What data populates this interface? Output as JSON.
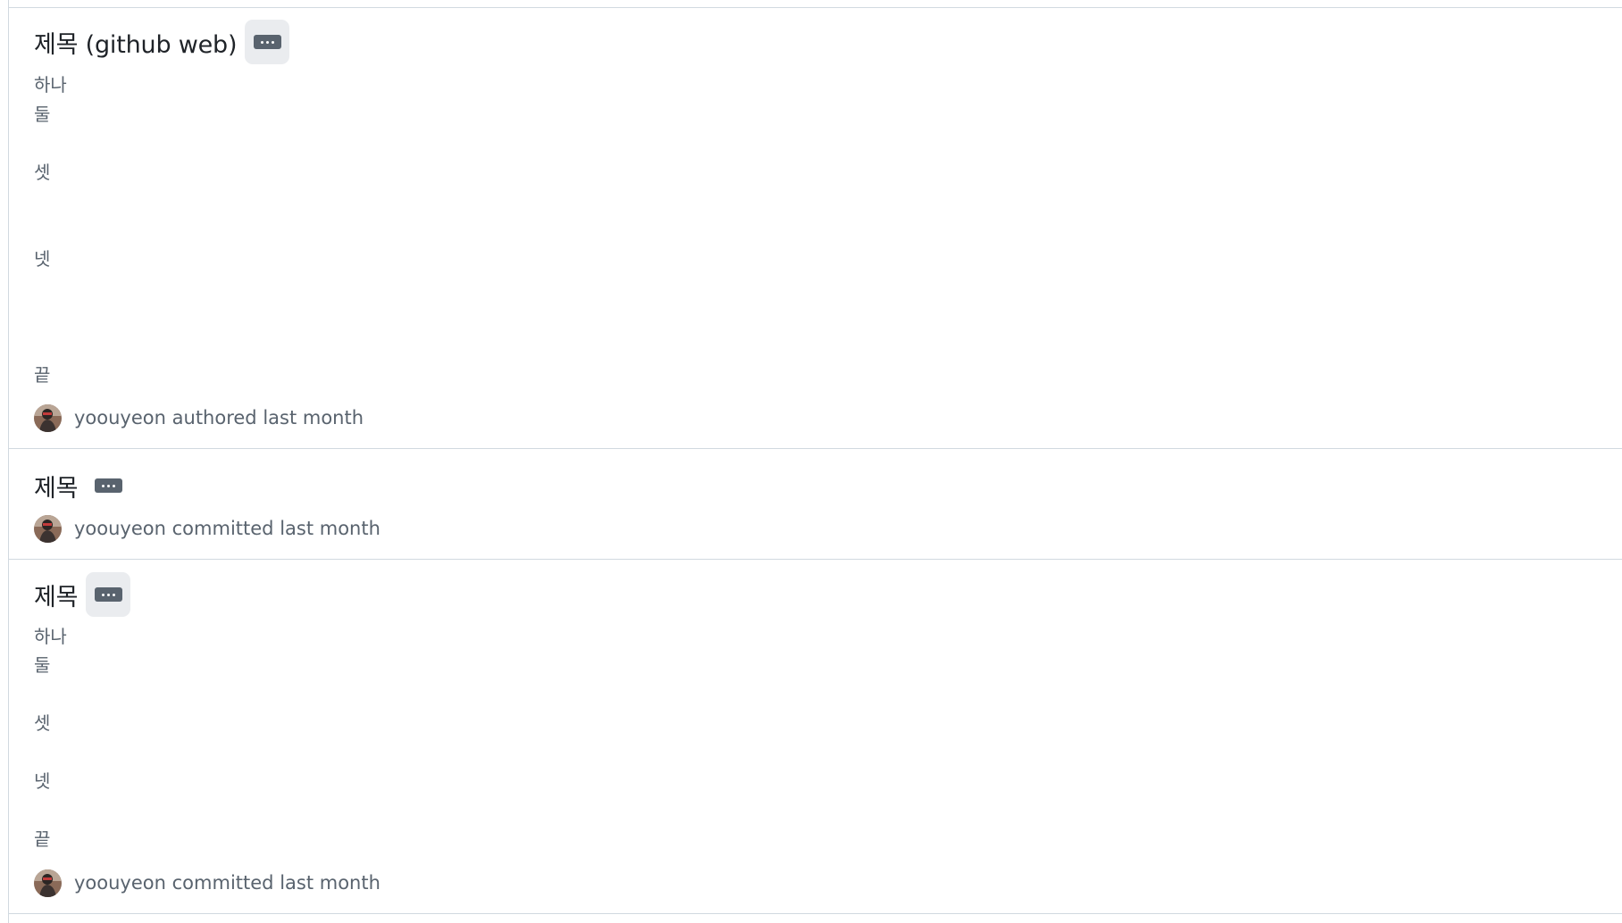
{
  "commits": [
    {
      "title": "제목 (github web)",
      "body": [
        "하나",
        "둘",
        "셋",
        "넷",
        "끝"
      ],
      "author": "yoouyeon",
      "action": "authored",
      "time": "last month"
    },
    {
      "title": "제목",
      "body": [],
      "author": "yoouyeon",
      "action": "committed",
      "time": "last month"
    },
    {
      "title": "제목",
      "body": [
        "하나",
        "둘",
        "셋",
        "넷",
        "끝"
      ],
      "author": "yoouyeon",
      "action": "committed",
      "time": "last month"
    }
  ],
  "icons": {
    "more": "kebab-horizontal-icon",
    "avatar": "user-avatar"
  },
  "colors": {
    "border": "#d1d9e0",
    "muted_text": "#59636e",
    "title_text": "#1f2328",
    "button_hover_bg": "#eaecef"
  }
}
